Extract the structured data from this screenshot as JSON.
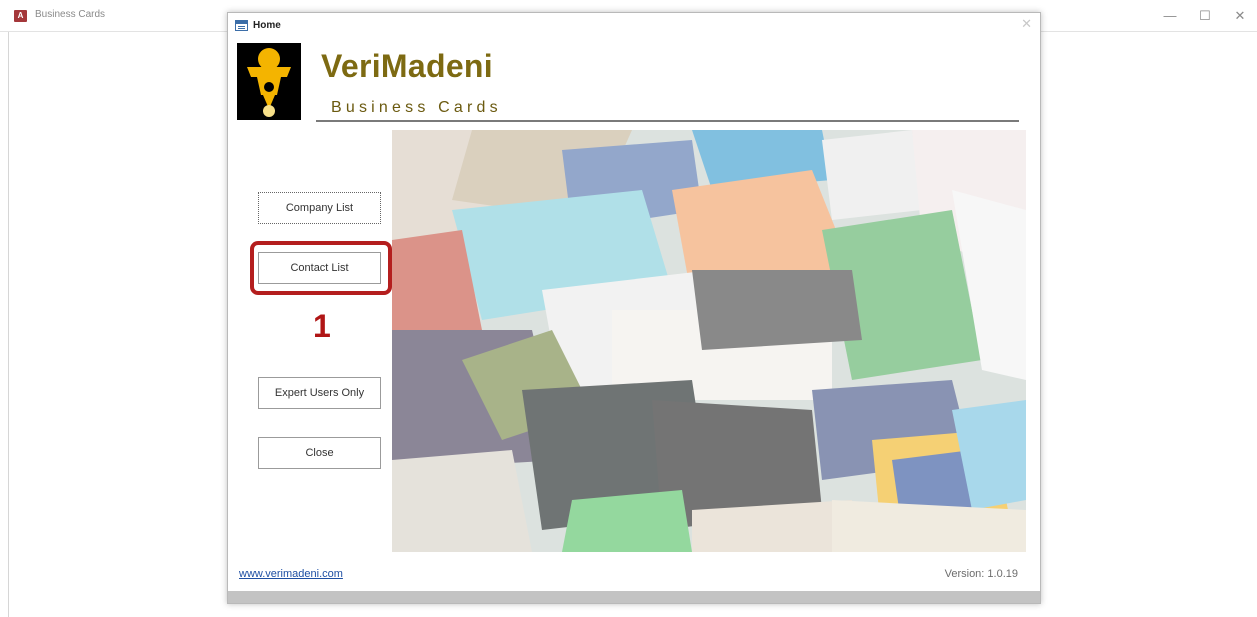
{
  "app": {
    "title": "Business Cards",
    "icon_text": "A",
    "controls": {
      "minimize": "—",
      "maximize": "☐",
      "close": "✕"
    }
  },
  "form": {
    "title": "Home",
    "close": "✕"
  },
  "brand": {
    "name": "VeriMadeni",
    "subtitle": "Business Cards",
    "name_color": "#7d6a12"
  },
  "buttons": {
    "company_list": "Company List",
    "contact_list": "Contact List",
    "expert_users": "Expert Users Only",
    "close": "Close"
  },
  "annotation": {
    "step_number": "1",
    "highlight_color": "#b41e1e"
  },
  "footer": {
    "link": "www.verimadeni.com",
    "version": "Version: 1.0.19"
  }
}
